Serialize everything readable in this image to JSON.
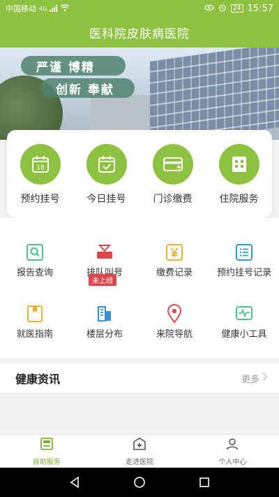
{
  "status_bar": {
    "carrier": "中国移动",
    "network": "4G",
    "battery": "24",
    "time": "15:57"
  },
  "header": {
    "title": "医科院皮肤病医院"
  },
  "banner": {
    "slogan1": "严谨 博精",
    "slogan2": "创新 奉献"
  },
  "quick_actions": [
    {
      "label": "预约挂号",
      "icon": "calendar-icon",
      "calendar_number": "18"
    },
    {
      "label": "今日挂号",
      "icon": "calendar-check-icon"
    },
    {
      "label": "门诊缴费",
      "icon": "card-icon"
    },
    {
      "label": "住院服务",
      "icon": "hospital-icon"
    }
  ],
  "services": [
    {
      "label": "报告查询",
      "icon": "search-report-icon",
      "color": "#4cc08d"
    },
    {
      "label": "排队叫号",
      "icon": "queue-icon",
      "color": "#e0474c",
      "badge": "未上线"
    },
    {
      "label": "缴费记录",
      "icon": "yuan-icon",
      "color": "#e8b32d"
    },
    {
      "label": "预约挂号记录",
      "icon": "list-icon",
      "color": "#27a3c9"
    },
    {
      "label": "就医指南",
      "icon": "book-icon",
      "color": "#e8b32d"
    },
    {
      "label": "楼层分布",
      "icon": "building-icon",
      "color": "#3b8ee0"
    },
    {
      "label": "来院导航",
      "icon": "location-pin-icon",
      "color": "#e0474c"
    },
    {
      "label": "健康小工具",
      "icon": "pulse-icon",
      "color": "#4cc08d"
    }
  ],
  "news": {
    "title": "健康资讯",
    "more": "更多"
  },
  "tabbar": [
    {
      "label": "自助服务",
      "icon": "self-service-icon",
      "active": true
    },
    {
      "label": "走进医院",
      "icon": "hospital-cross-icon",
      "active": false
    },
    {
      "label": "个人中心",
      "icon": "user-icon",
      "active": false
    }
  ],
  "colors": {
    "primary": "#8dc13f",
    "active_tab": "#7cb32c"
  }
}
